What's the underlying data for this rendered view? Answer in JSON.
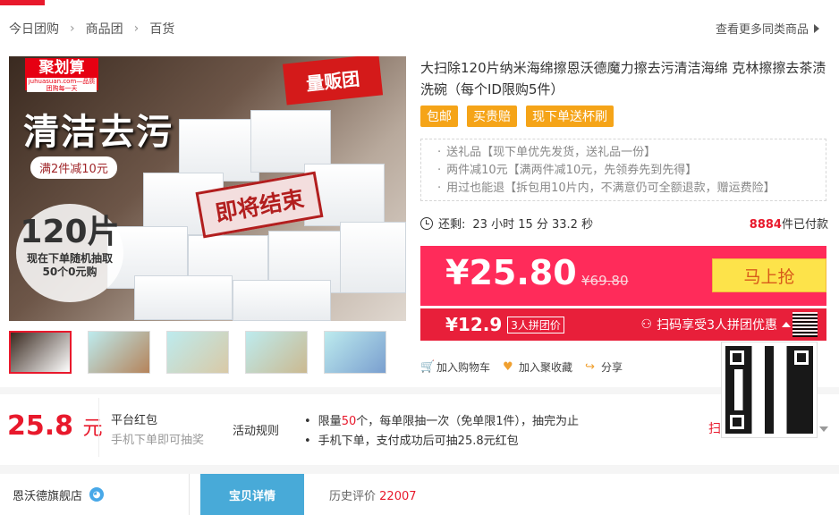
{
  "breadcrumb": {
    "items": [
      "今日团购",
      "商品团",
      "百货"
    ],
    "separator": "›"
  },
  "more_link": "查看更多同类商品",
  "main_image": {
    "logo_text": "聚划算",
    "logo_sub": "juhuasuan.com—品质团购每一天",
    "tag": "量贩团",
    "headline": "清洁去污",
    "promo": "满2件减10元",
    "ending": "即将结束",
    "count_number": "120片",
    "count_line1": "现在下单随机抽取",
    "count_line2": "50个0元购"
  },
  "product": {
    "title": "大扫除120片纳米海绵擦恩沃德魔力擦去污清洁海绵 克林擦擦去茶渍洗碗（每个ID限购5件）",
    "badges": [
      "包邮",
      "买贵赔",
      "现下单送杯刷"
    ],
    "gifts": [
      "送礼品【现下单优先发货，送礼品一份】",
      "两件减10元【满两件减10元，先领券先到先得】",
      "用过也能退【拆包用10片内，不满意仍可全额退款，赠运费险】"
    ]
  },
  "timer": {
    "label": "还剩:",
    "value": "23 小时 15 分 33.2 秒",
    "paid_count": "8884",
    "paid_label": "件已付款"
  },
  "price": {
    "current": "¥25.80",
    "original": "¥69.80",
    "buy_button": "马上抢",
    "group_price": "¥12.9",
    "group_tag": "3人拼团价",
    "scan_text": "扫码享受3人拼团优惠"
  },
  "actions": {
    "cart": "加入购物车",
    "favorite": "加入聚收藏",
    "share": "分享"
  },
  "hongbao": {
    "amount": "25.8",
    "unit": "元",
    "title": "平台红包",
    "subtitle": "手机下单即可抽奖",
    "rule_label": "活动规则",
    "rule_line1_pre": "限量",
    "rule_line1_num": "50",
    "rule_line1_post": "个，每单限抽一次（免单限1件），抽完为止",
    "rule_line2": "手机下单，支付成功后可抽25.8元红包",
    "right_hint": "扫"
  },
  "shop": {
    "name": "恩沃德旗舰店"
  },
  "tabs": {
    "detail": "宝贝详情",
    "reviews_label": "历史评价",
    "reviews_count": "22007"
  },
  "colors": {
    "accent_red": "#e8192c",
    "price_pink": "#ff2b5a",
    "badge_orange": "#f5a418",
    "buy_yellow": "#fde34a",
    "tab_blue": "#48aad8"
  }
}
